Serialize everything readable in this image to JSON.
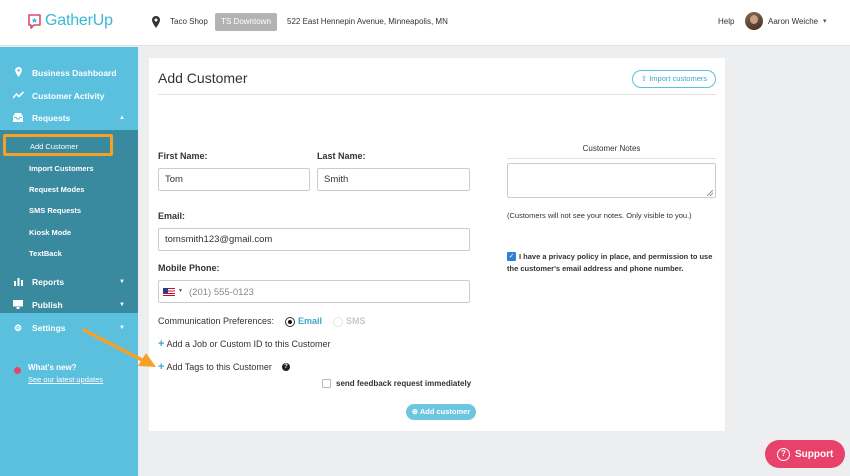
{
  "brand": {
    "name": "GatherUp",
    "accent": "#5bc0de",
    "highlight": "#f6a125",
    "support_color": "#e8416a"
  },
  "header": {
    "location_icon": "map-pin-icon",
    "location_name": "Taco Shop",
    "location_badge": "TS Downtown",
    "location_address": "522 East Hennepin Avenue, Minneapolis, MN",
    "help": "Help",
    "user_name": "Aaron Weiche"
  },
  "sidebar": {
    "main_items": [
      {
        "label": "Business Dashboard",
        "icon": "map-pin-icon"
      },
      {
        "label": "Customer Activity",
        "icon": "trend-line-icon"
      },
      {
        "label": "Requests",
        "icon": "inbox-icon",
        "expanded": true
      }
    ],
    "sub_items": [
      {
        "label": "Add Customer",
        "active": true
      },
      {
        "label": "Import Customers"
      },
      {
        "label": "Request Modes"
      },
      {
        "label": "SMS Requests"
      },
      {
        "label": "Kiosk Mode"
      },
      {
        "label": "TextBack"
      }
    ],
    "lower_items": [
      {
        "label": "Reports",
        "icon": "bar-chart-icon"
      },
      {
        "label": "Publish",
        "icon": "monitor-icon"
      },
      {
        "label": "Settings",
        "icon": "gear-icon"
      }
    ],
    "whats_new": "What's new?",
    "updates_link": "See our latest updates"
  },
  "form": {
    "title": "Add Customer",
    "import_button": "Import customers",
    "first_name_label": "First Name:",
    "first_name_value": "Tom",
    "last_name_label": "Last Name:",
    "last_name_value": "Smith",
    "email_label": "Email:",
    "email_value": "tomsmith123@gmail.com",
    "phone_label": "Mobile Phone:",
    "phone_placeholder": "(201) 555-0123",
    "comm_label": "Communication Preferences:",
    "comm_email": "Email",
    "comm_sms": "SMS",
    "comm_selected": "Email",
    "add_job_link": "Add a Job or Custom ID to this Customer",
    "add_tags_link": "Add Tags to this Customer",
    "send_feedback_label": "send feedback request immediately",
    "send_feedback_checked": false,
    "submit_button": "Add customer"
  },
  "notes": {
    "title": "Customer Notes",
    "hint": "(Customers will not see your notes. Only visible to you.)",
    "privacy_text": "I have a privacy policy in place, and permission to use the customer's email address and phone number.",
    "privacy_checked": true
  },
  "support": {
    "label": "Support"
  }
}
